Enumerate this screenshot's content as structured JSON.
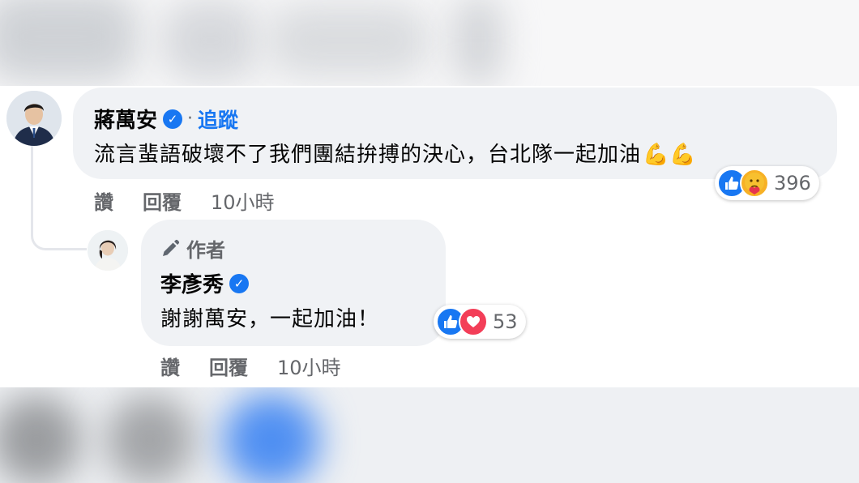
{
  "comment": {
    "author": "蔣萬安",
    "separator": "·",
    "follow_label": "追蹤",
    "text": "流言蜚語破壞不了我們團結拚搏的決心，台北隊一起加油",
    "emoji": "💪💪",
    "reaction_count": "396",
    "actions": {
      "like": "讚",
      "reply": "回覆",
      "time": "10小時"
    }
  },
  "reply": {
    "badge_label": "作者",
    "author": "李彥秀",
    "text": "謝謝萬安，一起加油！",
    "reaction_count": "53",
    "actions": {
      "like": "讚",
      "reply": "回覆",
      "time": "10小時"
    }
  },
  "colors": {
    "accent": "#1877f2",
    "bubble": "#f0f2f5",
    "secondary_text": "#65676b",
    "love": "#f33e58",
    "care": "#f7b125"
  },
  "icons": [
    "verified-badge-icon",
    "like-reaction-icon",
    "care-reaction-icon",
    "love-reaction-icon",
    "pencil-icon"
  ]
}
